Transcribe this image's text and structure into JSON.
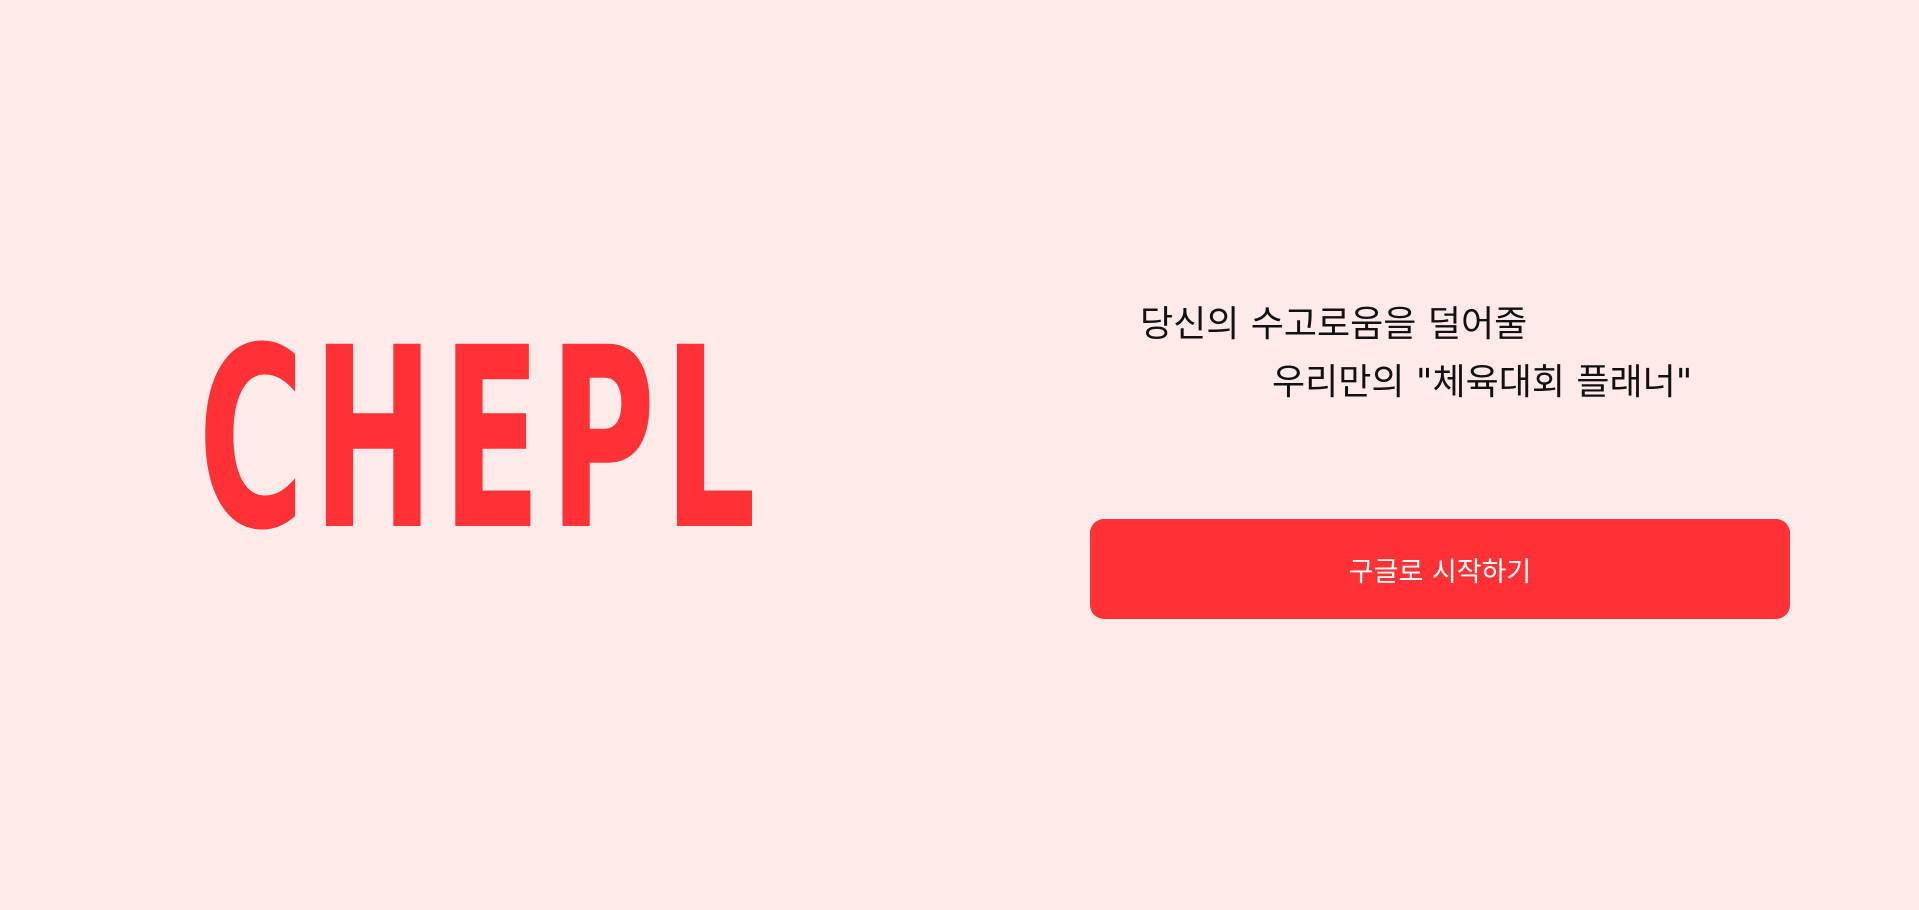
{
  "brand": {
    "logo_text": "CHEPL",
    "accent_color": "#ff3336",
    "background_color": "#ffe9e9"
  },
  "hero": {
    "tagline_line1": "당신의 수고로움을 덜어줄",
    "tagline_line2": "우리만의 \"체육대회 플래너\""
  },
  "actions": {
    "google_start_label": "구글로 시작하기"
  }
}
